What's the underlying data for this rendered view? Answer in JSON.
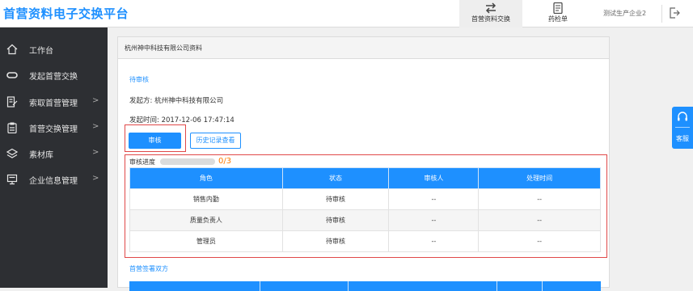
{
  "app": {
    "title": "首营资料电子交换平台"
  },
  "nav": {
    "tabs": [
      {
        "label": "首营资料交换",
        "icon": "exchange-arrows-icon",
        "active": true
      },
      {
        "label": "药检单",
        "icon": "document-icon",
        "active": false
      }
    ],
    "company": "测试生产企业2",
    "logout_icon": "logout-icon"
  },
  "sidebar": {
    "items": [
      {
        "label": "工作台",
        "icon": "home-icon",
        "has_arrow": false
      },
      {
        "label": "发起首营交换",
        "icon": "link-icon",
        "has_arrow": false
      },
      {
        "label": "索取首营管理",
        "icon": "edit-doc-icon",
        "has_arrow": true
      },
      {
        "label": "首营交换管理",
        "icon": "clipboard-icon",
        "has_arrow": true
      },
      {
        "label": "素材库",
        "icon": "layers-icon",
        "has_arrow": true
      },
      {
        "label": "企业信息管理",
        "icon": "monitor-icon",
        "has_arrow": true
      }
    ]
  },
  "panel": {
    "title": "杭州神中科技有限公司资料",
    "status": "待审核",
    "initiator": "发起方: 杭州神中科技有限公司",
    "initiated_time": "发起时间: 2017-12-06 17:47:14",
    "btn_review": "审核",
    "btn_history": "历史记录查看"
  },
  "progress": {
    "label": "审核进度",
    "count": "0/3",
    "value": 0
  },
  "review_table": {
    "headers": [
      "角色",
      "状态",
      "审核人",
      "处理时间"
    ],
    "rows": [
      [
        "销售内勤",
        "待审核",
        "--",
        "--"
      ],
      [
        "质量负责人",
        "待审核",
        "--",
        "--"
      ],
      [
        "管理员",
        "待审核",
        "--",
        "--"
      ]
    ]
  },
  "section2": {
    "title": "首营签署双方"
  },
  "service": {
    "label": "客服",
    "icon": "headset-icon"
  },
  "colors": {
    "accent": "#1e90ff",
    "highlight": "#e04848",
    "sidebar": "#2d2f33",
    "progress_text": "#ff7a00"
  }
}
